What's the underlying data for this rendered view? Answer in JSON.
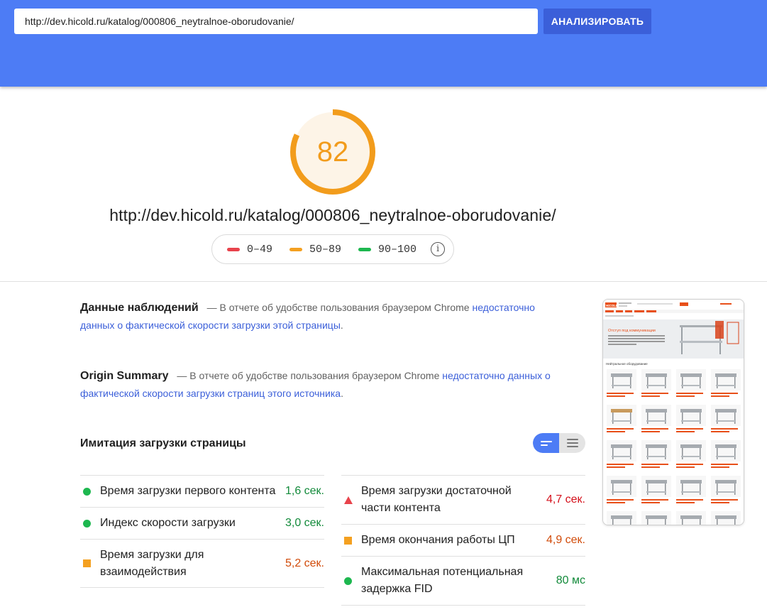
{
  "header": {
    "url_value": "http://dev.hicold.ru/katalog/000806_neytralnoe-oborudovanie/",
    "analyze_label": "АНАЛИЗИРОВАТЬ",
    "bg_color": "#4d7cf5"
  },
  "score": {
    "value": "82",
    "fraction": 0.82,
    "color": "#f29c1c"
  },
  "page_url": "http://dev.hicold.ru/katalog/000806_neytralnoe-oborudovanie/",
  "legend": {
    "items": [
      {
        "range": "0–49",
        "color": "#e8434c"
      },
      {
        "range": "50–89",
        "color": "#f4a020"
      },
      {
        "range": "90–100",
        "color": "#1db74f"
      }
    ],
    "info_icon": "info-icon"
  },
  "field_data": {
    "title": "Данные наблюдений",
    "text": "— В отчете об удобстве пользования браузером Chrome",
    "link": "недостаточно данных о фактической скорости загрузки этой страницы",
    "end": "."
  },
  "origin_summary": {
    "title": "Origin Summary",
    "text": "— В отчете об удобстве пользования браузером Chrome",
    "link": "недостаточно данных о фактической скорости загрузки страниц этого источника",
    "end": "."
  },
  "lab_data": {
    "title": "Имитация загрузки страницы",
    "toggle": [
      "view-compact-icon",
      "view-list-icon"
    ]
  },
  "metrics_left": [
    {
      "label": "Время загрузки первого контента",
      "value": "1,6 сек.",
      "status": "green-dot"
    },
    {
      "label": "Индекс скорости загрузки",
      "value": "3,0 сек.",
      "status": "green-dot"
    },
    {
      "label": "Время загрузки для взаимодействия",
      "value": "5,2 сек.",
      "status": "orange-square"
    }
  ],
  "metrics_right": [
    {
      "label": "Время загрузки достаточной части контента",
      "value": "4,7 сек.",
      "status": "red-triangle"
    },
    {
      "label": "Время окончания работы ЦП",
      "value": "4,9 сек.",
      "status": "orange-square"
    },
    {
      "label": "Максимальная потенциальная задержка FID",
      "value": "80 мс",
      "status": "green-dot"
    }
  ],
  "thumbnail": {
    "logo_text": "HiCOLD",
    "hero_title": "Отступ под коммуникации",
    "section_title": "Нейтральное оборудование"
  }
}
